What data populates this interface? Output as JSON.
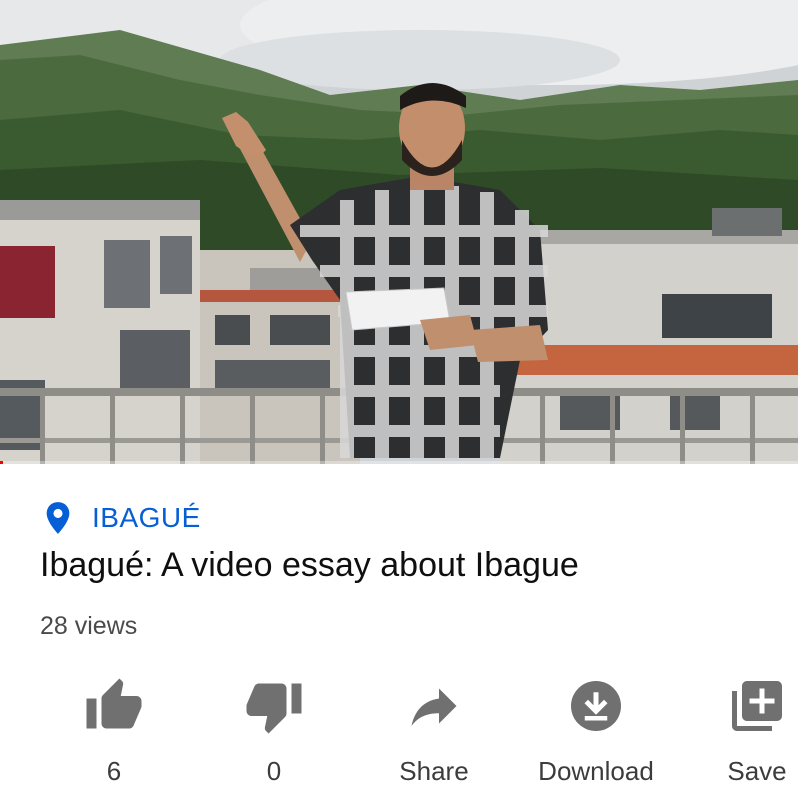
{
  "video": {
    "thumbnail": "man-with-paper-on-rooftop-mountains-background",
    "progress_percent": 0.4
  },
  "location": {
    "icon": "location-pin-icon",
    "label": "IBAGUÉ",
    "color": "#065fd4"
  },
  "title": "Ibagué: A video essay about Ibague",
  "views": "28 views",
  "actions": {
    "like": {
      "icon": "thumbs-up-icon",
      "label": "6"
    },
    "dislike": {
      "icon": "thumbs-down-icon",
      "label": "0"
    },
    "share": {
      "icon": "share-icon",
      "label": "Share"
    },
    "download": {
      "icon": "download-icon",
      "label": "Download"
    },
    "save": {
      "icon": "save-to-playlist-icon",
      "label": "Save"
    }
  }
}
